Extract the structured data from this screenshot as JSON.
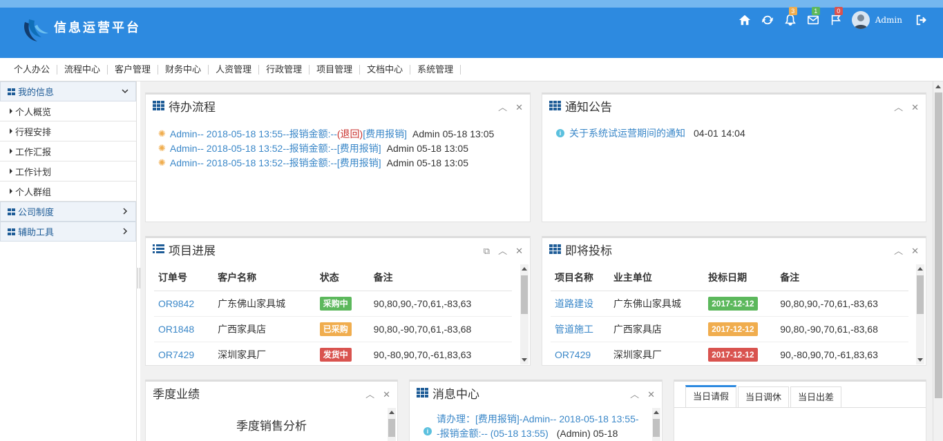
{
  "app": {
    "title": "信息运营平台",
    "user": "Admin"
  },
  "header_badges": {
    "bell": "3",
    "mail": "1",
    "flag": "0"
  },
  "colors": {
    "header": "#2d8ae0",
    "link": "#3a87c8",
    "green": "#5cb85c",
    "orange": "#f0ad4e",
    "red": "#d9534f"
  },
  "nav": [
    "个人办公",
    "流程中心",
    "客户管理",
    "财务中心",
    "人资管理",
    "行政管理",
    "项目管理",
    "文档中心",
    "系统管理"
  ],
  "sidebar": {
    "group1": "我的信息",
    "items": [
      "个人概览",
      "行程安排",
      "工作汇报",
      "工作计划",
      "个人群组"
    ],
    "group2": "公司制度",
    "group3": "辅助工具"
  },
  "todo": {
    "title": "待办流程",
    "rows": [
      {
        "prefix": "Admin-- 2018-05-18 13:55--报销金额:--",
        "tag": "(退回)",
        "type": "[费用报销]",
        "meta": "Admin  05-18 13:05"
      },
      {
        "prefix": "Admin-- 2018-05-18 13:52--报销金额:--",
        "tag": "",
        "type": "[费用报销]",
        "meta": "Admin  05-18 13:05"
      },
      {
        "prefix": "Admin-- 2018-05-18 13:52--报销金额:--",
        "tag": "",
        "type": "[费用报销]",
        "meta": "Admin  05-18 13:05"
      }
    ]
  },
  "notice": {
    "title": "通知公告",
    "text": "关于系统试运营期间的通知",
    "time": "04-01 14:04"
  },
  "progress": {
    "title": "项目进展",
    "headers": [
      "订单号",
      "客户名称",
      "状态",
      "备注"
    ],
    "rows": [
      {
        "id": "OR9842",
        "client": "广东佛山家具城",
        "status": "采购中",
        "note": "90,80,90,-70,61,-83,63"
      },
      {
        "id": "OR1848",
        "client": "广西家具店",
        "status": "已采购",
        "note": "90,80,-90,70,61,-83,68"
      },
      {
        "id": "OR7429",
        "client": "深圳家具厂",
        "status": "发货中",
        "note": "90,-80,90,70,-61,83,63"
      }
    ]
  },
  "bidding": {
    "title": "即将投标",
    "headers": [
      "项目名称",
      "业主单位",
      "投标日期",
      "备注"
    ],
    "rows": [
      {
        "name": "道路建设",
        "owner": "广东佛山家具城",
        "date": "2017-12-12",
        "note": "90,80,90,-70,61,-83,63"
      },
      {
        "name": "管道施工",
        "owner": "广西家具店",
        "date": "2017-12-12",
        "note": "90,80,-90,70,61,-83,68"
      },
      {
        "name": "OR7429",
        "owner": "深圳家具厂",
        "date": "2017-12-12",
        "note": "90,-80,90,70,-61,83,63"
      }
    ]
  },
  "quarter": {
    "title": "季度业绩",
    "chart_title": "季度销售分析"
  },
  "messages": {
    "title": "消息中心",
    "line1": "请办理：[费用报销]-Admin-- 2018-05-18 13:55-",
    "line2": "-报销金额:-- (05-18 13:55)",
    "meta": "(Admin)  05-18"
  },
  "leave_tabs": [
    "当日请假",
    "当日调休",
    "当日出差"
  ]
}
